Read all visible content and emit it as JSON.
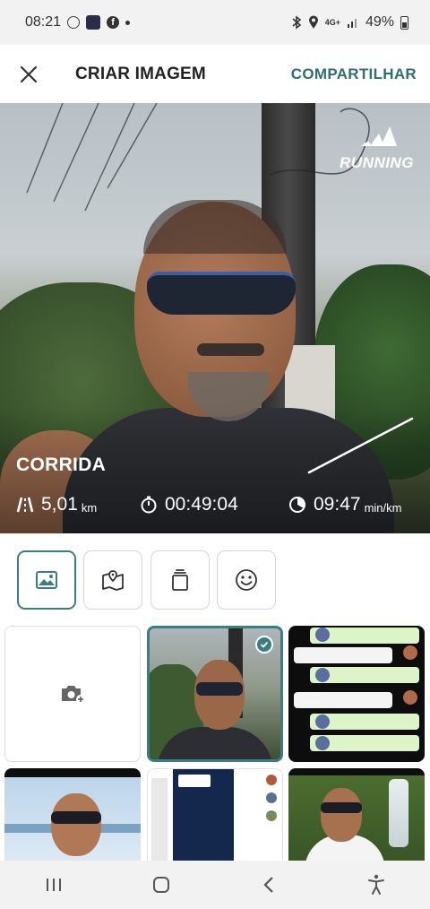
{
  "status_bar": {
    "time": "08:21",
    "network": "4G+",
    "battery": "49%"
  },
  "header": {
    "title": "CRIAR IMAGEM",
    "share_label": "COMPARTILHAR"
  },
  "preview": {
    "brand_text": "RUNNING",
    "activity": "CORRIDA",
    "distance_value": "5,01",
    "distance_unit": "km",
    "duration_value": "00:49:04",
    "pace_value": "09:47",
    "pace_unit": "min/km"
  },
  "tools": [
    "image",
    "map",
    "layers",
    "sticker"
  ],
  "active_tool": "image",
  "gallery": {
    "selected_index": 1
  },
  "colors": {
    "accent": "#3c7d80",
    "share": "#2f6f72"
  }
}
